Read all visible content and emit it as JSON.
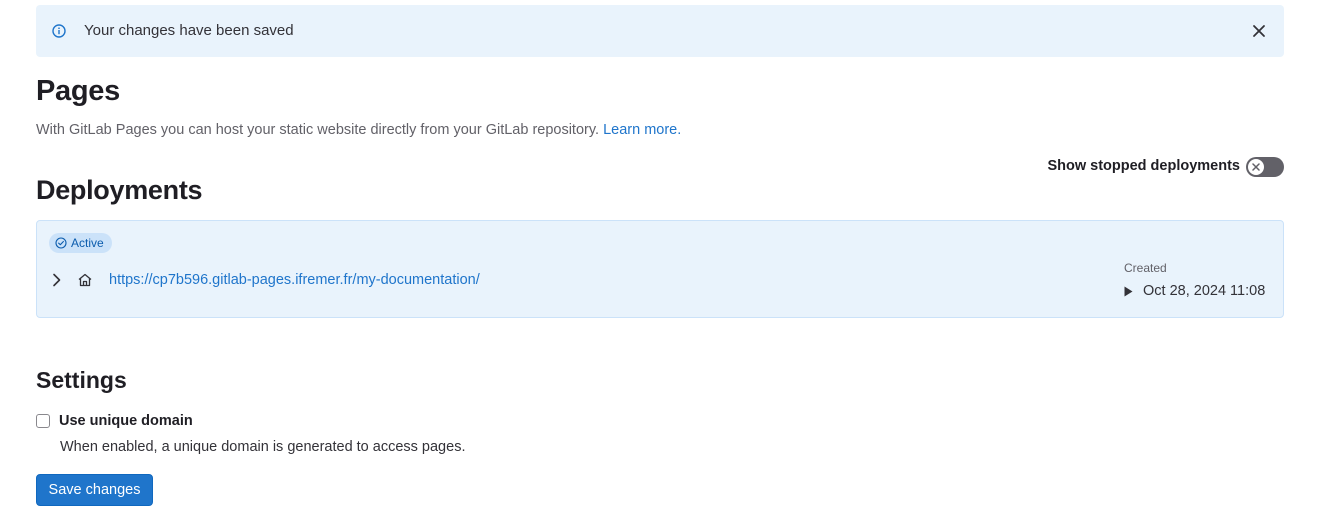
{
  "alert": {
    "message": "Your changes have been saved"
  },
  "page": {
    "title": "Pages",
    "description": "With GitLab Pages you can host your static website directly from your GitLab repository.",
    "learn_more": "Learn more."
  },
  "toggle": {
    "label": "Show stopped deployments",
    "enabled": false
  },
  "deployments": {
    "title": "Deployments",
    "items": [
      {
        "status": "Active",
        "url": "https://cp7b596.gitlab-pages.ifremer.fr/my-documentation/",
        "created_label": "Created",
        "created_date": "Oct 28, 2024 11:08"
      }
    ]
  },
  "settings": {
    "title": "Settings",
    "unique_domain_label": "Use unique domain",
    "unique_domain_checked": false,
    "unique_domain_help": "When enabled, a unique domain is generated to access pages.",
    "save_label": "Save changes"
  },
  "colors": {
    "accent": "#1f75cb",
    "alert_bg": "#e9f3fc",
    "toggle_off": "#626168"
  }
}
